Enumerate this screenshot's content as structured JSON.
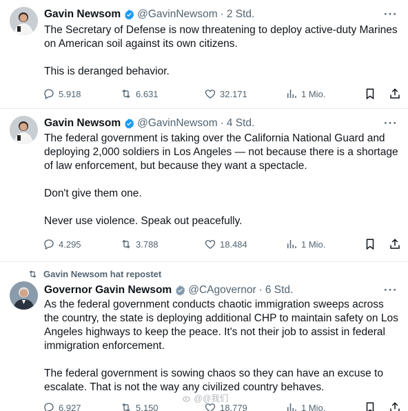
{
  "tweets": [
    {
      "name": "Gavin Newsom",
      "handle": "@GavinNewsom",
      "time": "2 Std.",
      "paragraphs": [
        "The Secretary of Defense is now threatening to deploy active-duty Marines",
        "on American soil against its own citizens.",
        "",
        "This is deranged behavior."
      ],
      "replies": "5.918",
      "reposts": "6.631",
      "likes": "32.171",
      "views": "1 Mio."
    },
    {
      "name": "Gavin Newsom",
      "handle": "@GavinNewsom",
      "time": "4 Std.",
      "paragraphs": [
        "The federal government is taking over the California National Guard and",
        "deploying 2,000 soldiers in Los Angeles — not because there is a shortage",
        "of law enforcement, but because they want a spectacle.",
        "",
        "Don't give them one.",
        "",
        "Never use violence. Speak out peacefully."
      ],
      "replies": "4.295",
      "reposts": "3.788",
      "likes": "18.484",
      "views": "1 Mio."
    },
    {
      "repost_label": "Gavin Newsom hat repostet",
      "name": "Governor Gavin Newsom",
      "handle": "@CAgovernor",
      "time": "6 Std.",
      "paragraphs": [
        "As the federal government conducts chaotic immigration sweeps across",
        "the country, the state is deploying additional CHP to maintain safety on Los",
        "Angeles highways to keep the peace. It's not their job to assist in federal",
        "immigration enforcement.",
        "",
        "The federal government is sowing chaos so they can have an excuse to",
        "escalate. That is not the way any civilized country behaves."
      ],
      "replies": "6.927",
      "reposts": "5.150",
      "likes": "18.779",
      "views": "1 Mio."
    }
  ],
  "watermark": "@@我们"
}
